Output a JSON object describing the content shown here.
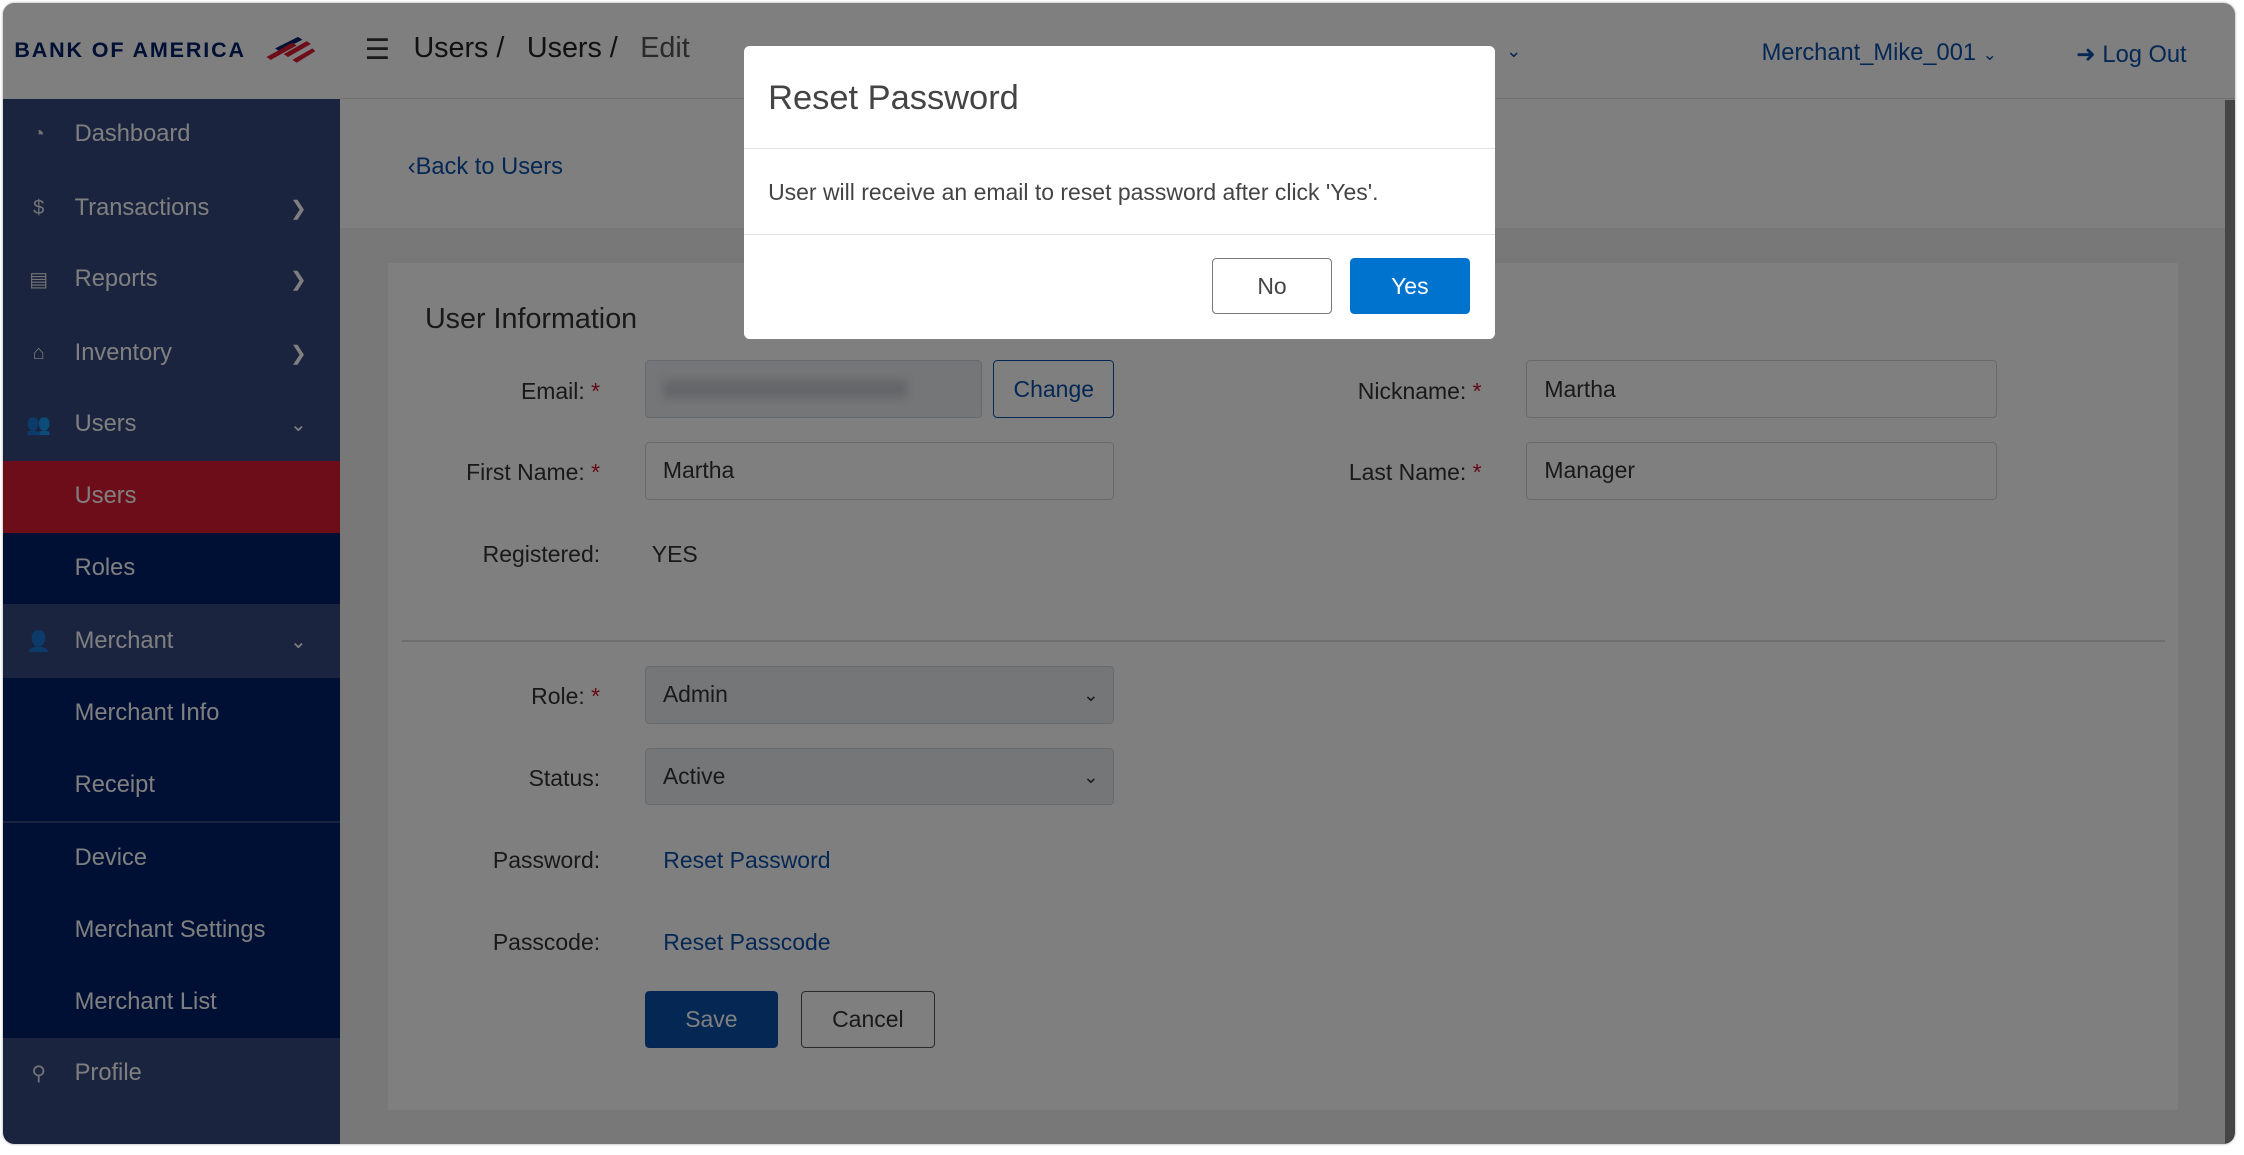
{
  "brand": {
    "logo_text": "BANK OF AMERICA"
  },
  "breadcrumb": [
    "Users /",
    "Users /",
    "Edit"
  ],
  "header": {
    "merchant": "Merchant_Mike_001",
    "logout": "Log Out"
  },
  "sidebar": {
    "items": [
      {
        "label": "Dashboard",
        "icon": "dashboard-icon"
      },
      {
        "label": "Transactions",
        "icon": "coins-icon"
      },
      {
        "label": "Reports",
        "icon": "reports-icon"
      },
      {
        "label": "Inventory",
        "icon": "inventory-icon"
      },
      {
        "label": "Users",
        "icon": "users-icon"
      },
      {
        "label": "Users"
      },
      {
        "label": "Roles"
      },
      {
        "label": "Merchant",
        "icon": "merchant-icon"
      },
      {
        "label": "Merchant Info"
      },
      {
        "label": "Receipt"
      },
      {
        "label": "Device"
      },
      {
        "label": "Merchant Settings"
      },
      {
        "label": "Merchant List"
      },
      {
        "label": "Profile",
        "icon": "profile-icon"
      }
    ]
  },
  "back_link": "Back to Users",
  "form": {
    "title": "User Information",
    "email_label": "Email:",
    "change_label": "Change",
    "nickname_label": "Nickname:",
    "nickname": "Martha",
    "first_name_label": "First Name:",
    "first_name": "Martha",
    "last_name_label": "Last Name:",
    "last_name": "Manager",
    "registered_label": "Registered:",
    "registered": "YES",
    "role_label": "Role:",
    "role": "Admin",
    "status_label": "Status:",
    "status": "Active",
    "password_label": "Password:",
    "reset_password": "Reset Password",
    "passcode_label": "Passcode:",
    "reset_passcode": "Reset Passcode",
    "save": "Save",
    "cancel": "Cancel",
    "required": "*"
  },
  "modal": {
    "title": "Reset Password",
    "message": "User will receive an email to reset password after click 'Yes'.",
    "no": "No",
    "yes": "Yes"
  },
  "colors": {
    "accent": "#0073cf",
    "navy": "#012169",
    "red": "#dc1a34"
  }
}
